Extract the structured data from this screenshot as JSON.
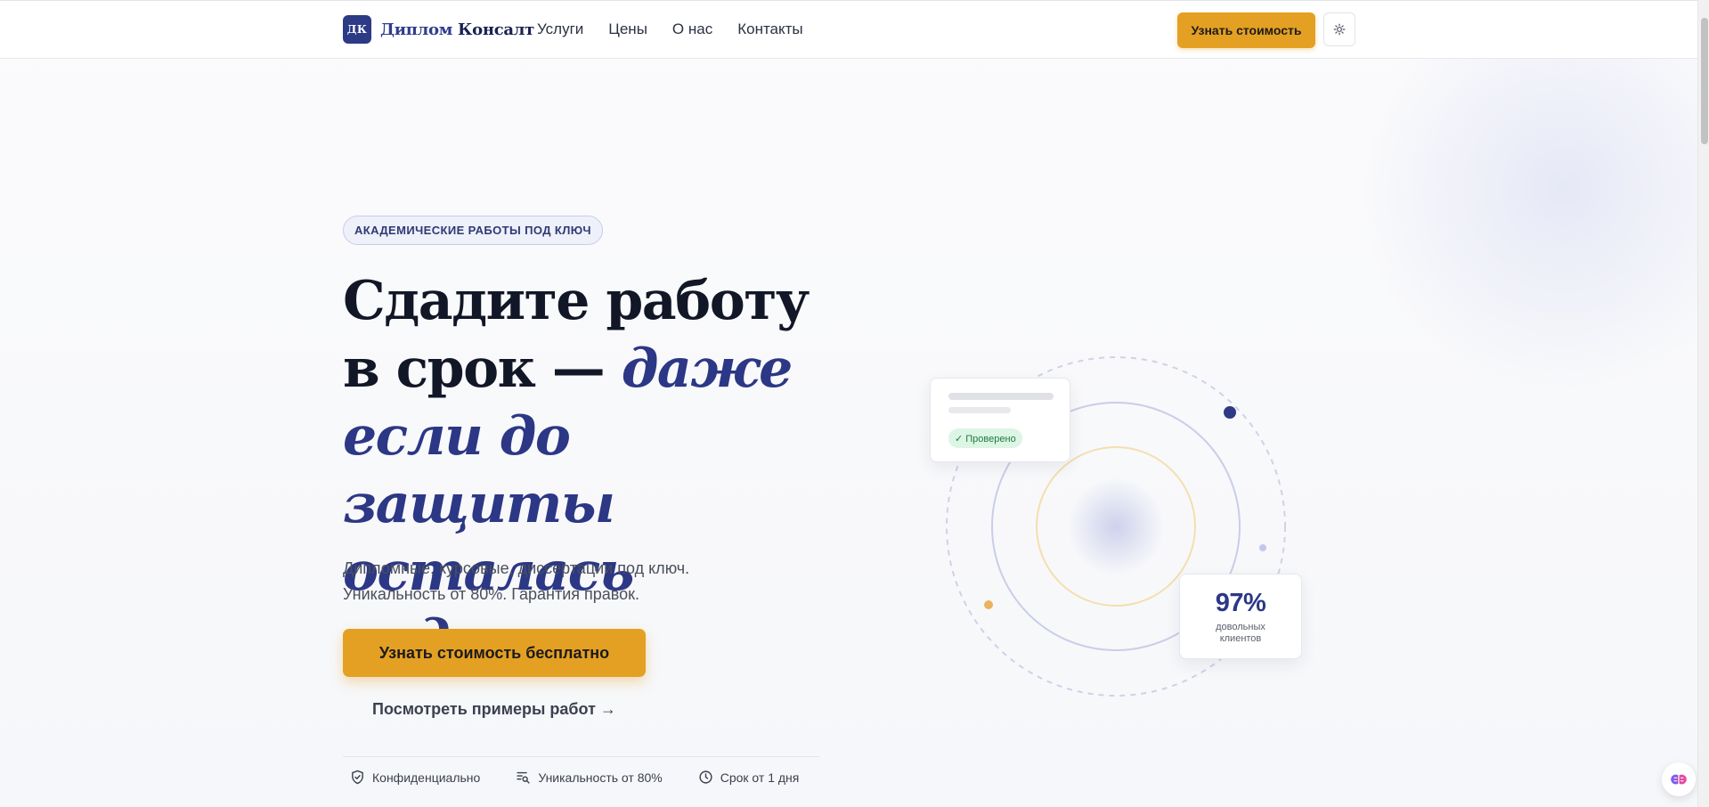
{
  "header": {
    "logo_badge": "ДК",
    "logo_name_part1": "Диплом",
    "logo_name_part2": "Консалт",
    "nav": [
      "Услуги",
      "Цены",
      "О нас",
      "Контакты"
    ],
    "cta_label": "Узнать стоимость",
    "theme_toggle_icon": "sun-icon"
  },
  "hero": {
    "badge": "АКАДЕМИЧЕСКИЕ РАБОТЫ ПОД КЛЮЧ",
    "headline_plain": "Сдадите работу в срок — ",
    "headline_accent": "даже если до защиты осталась неделя",
    "subtitle_line1": "Дипломные, курсовые, диссертации под ключ.",
    "subtitle_line2": "Уникальность от 80%. Гарантия правок.",
    "cta_primary": "Узнать стоимость бесплатно",
    "cta_secondary": "Посмотреть примеры работ →",
    "features": [
      {
        "icon": "shield-check-icon",
        "label": "Конфиденциально"
      },
      {
        "icon": "text-search-icon",
        "label": "Уникальность от 80%"
      },
      {
        "icon": "clock-icon",
        "label": "Срок от 1 дня"
      }
    ]
  },
  "illustration": {
    "verified_label": "✓ Проверено",
    "stat_value": "97%",
    "stat_label_line1": "довольных",
    "stat_label_line2": "клиентов"
  },
  "colors": {
    "accent": "#e4a023",
    "brand": "#2c3785",
    "verified_bg": "#dcf5e4",
    "verified_text": "#1f7a43"
  },
  "widgets": {
    "chat_icon": "brain-icon"
  }
}
